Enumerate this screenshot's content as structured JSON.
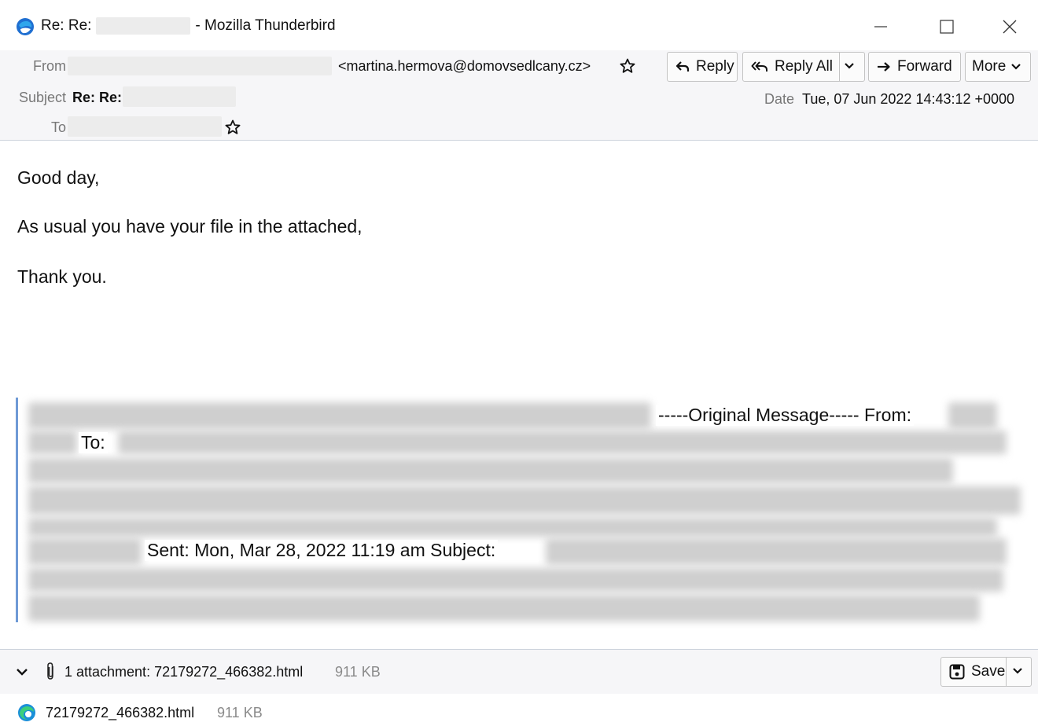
{
  "window": {
    "title_prefix": "Re: Re:",
    "title_suffix": "- Mozilla Thunderbird",
    "app_icon": "thunderbird-logo",
    "controls": [
      "minimize",
      "maximize",
      "close"
    ]
  },
  "header": {
    "from_label": "From",
    "from_email": "<martina.hermova@domovsedlcany.cz>",
    "subject_label": "Subject",
    "subject_value": "Re: Re:",
    "to_label": "To",
    "date_label": "Date",
    "date_value": "Tue, 07 Jun 2022 14:43:12 +0000",
    "buttons": {
      "reply": "Reply",
      "reply_all": "Reply All",
      "forward": "Forward",
      "more": "More"
    }
  },
  "body": {
    "lines": [
      "Good day,",
      "As usual you have your file in the attached,",
      "Thank you."
    ],
    "quote": {
      "original_message": "-----Original Message----- From:",
      "to": "To:",
      "sent": "Sent: Mon, Mar 28, 2022 11:19 am Subject:"
    }
  },
  "attachments": {
    "summary": "1 attachment: 72179272_466382.html",
    "total_size": "911 KB",
    "save_label": "Save",
    "items": [
      {
        "name": "72179272_466382.html",
        "size": "911 KB",
        "icon": "edge-icon"
      }
    ]
  },
  "colors": {
    "header_bg": "#f6f6f8",
    "quote_bar": "#6f9ad6",
    "muted_text": "#8a8a8a"
  }
}
